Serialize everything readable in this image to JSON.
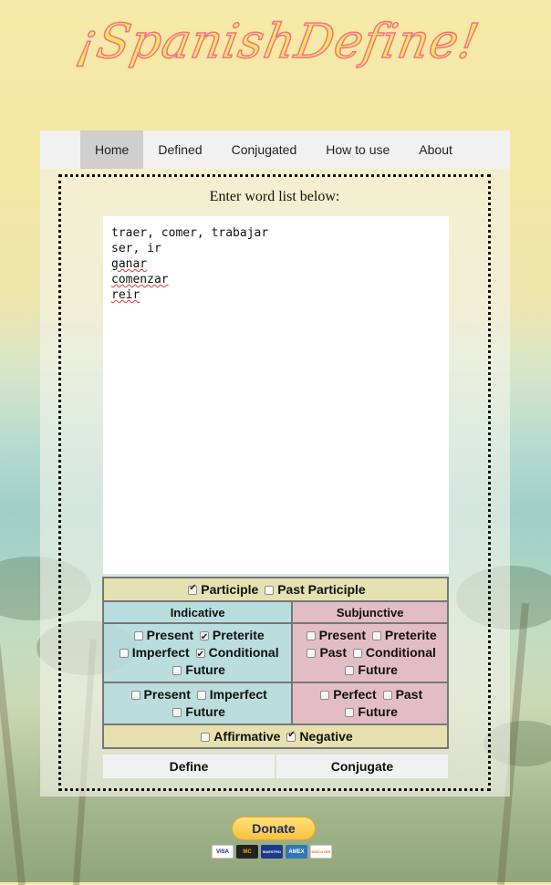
{
  "app": {
    "logo_text": "¡SpanishDefine!"
  },
  "nav": {
    "items": [
      {
        "label": "Home",
        "active": true
      },
      {
        "label": "Defined",
        "active": false
      },
      {
        "label": "Conjugated",
        "active": false
      },
      {
        "label": "How to use",
        "active": false
      },
      {
        "label": "About",
        "active": false
      }
    ]
  },
  "form": {
    "prompt": "Enter word list below:",
    "word_list_lines": [
      "traer, comer, trabajar",
      "ser, ir",
      "ganar",
      "comenzar",
      "reir"
    ]
  },
  "options": {
    "participle": {
      "label": "Participle",
      "checked": true
    },
    "past_participle": {
      "label": "Past Participle",
      "checked": false
    },
    "indicative": {
      "header": "Indicative",
      "present": {
        "label": "Present",
        "checked": false
      },
      "preterite": {
        "label": "Preterite",
        "checked": true
      },
      "imperfect": {
        "label": "Imperfect",
        "checked": false
      },
      "conditional": {
        "label": "Conditional",
        "checked": true
      },
      "future": {
        "label": "Future",
        "checked": false
      },
      "perfect_present": {
        "label": "Present",
        "checked": false
      },
      "perfect_imperfect": {
        "label": "Imperfect",
        "checked": false
      },
      "perfect_future": {
        "label": "Future",
        "checked": false
      }
    },
    "subjunctive": {
      "header": "Subjunctive",
      "present": {
        "label": "Present",
        "checked": false
      },
      "preterite": {
        "label": "Preterite",
        "checked": false
      },
      "past": {
        "label": "Past",
        "checked": false
      },
      "conditional": {
        "label": "Conditional",
        "checked": false
      },
      "future": {
        "label": "Future",
        "checked": false
      },
      "perfect_perfect": {
        "label": "Perfect",
        "checked": false
      },
      "perfect_past": {
        "label": "Past",
        "checked": false
      },
      "perfect_future": {
        "label": "Future",
        "checked": false
      }
    },
    "affirmative": {
      "label": "Affirmative",
      "checked": false
    },
    "negative": {
      "label": "Negative",
      "checked": true
    }
  },
  "buttons": {
    "define": "Define",
    "conjugate": "Conjugate"
  },
  "donate": {
    "label": "Donate",
    "cards": [
      "VISA",
      "MC",
      "MAESTRO",
      "AMEX",
      "DISCOVER"
    ]
  },
  "colors": {
    "nav_active": "#cfcfcf",
    "indicative_bg": "#aad7de",
    "subjunctive_bg": "#e2aabe",
    "participle_bg": "#e9dea0"
  }
}
